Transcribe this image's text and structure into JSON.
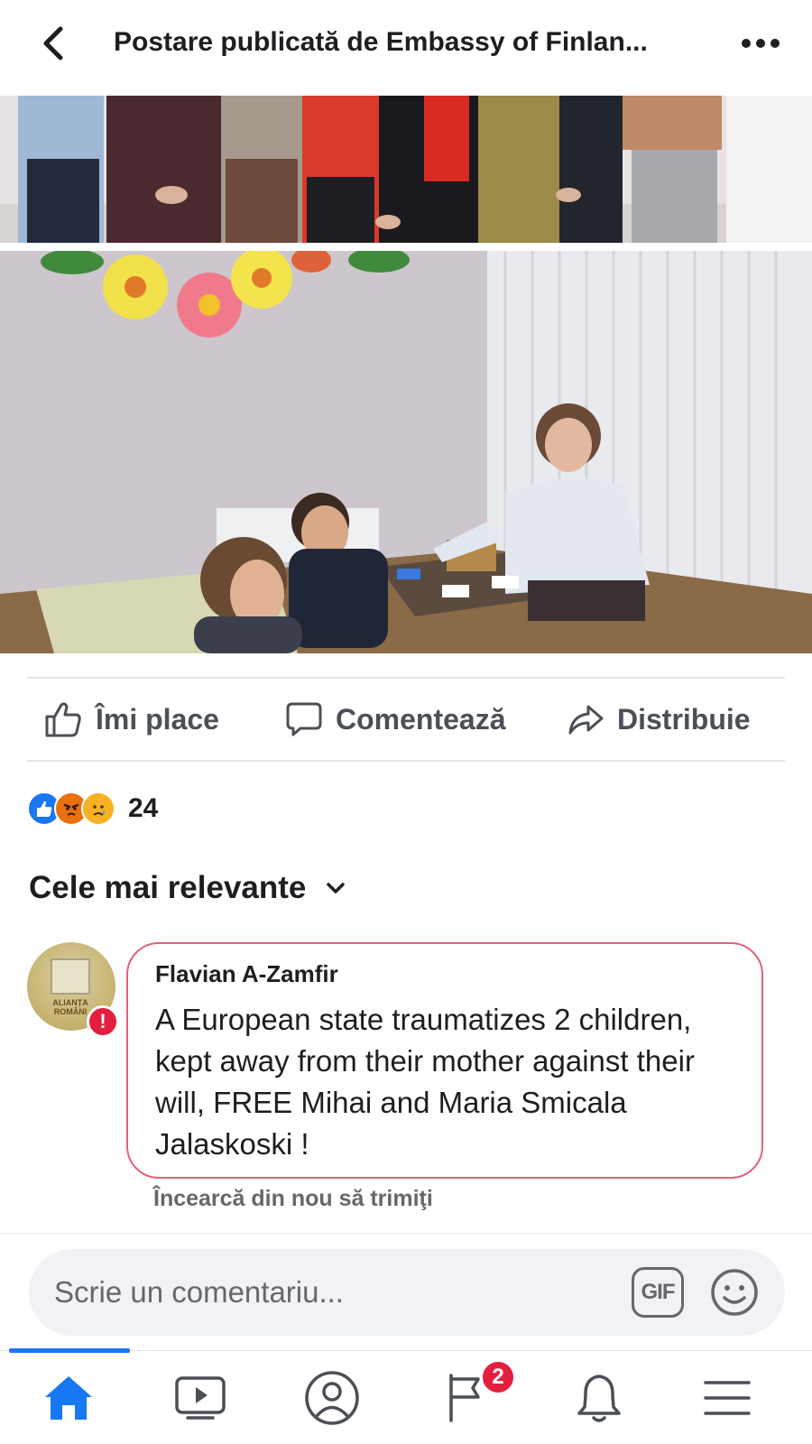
{
  "header": {
    "title": "Postare publicată de Embassy of Finlan...",
    "back_icon": "chevron-left-icon",
    "more_icon": "more-horizontal-icon"
  },
  "actions": {
    "like_label": "Îmi place",
    "comment_label": "Comentează",
    "share_label": "Distribuie"
  },
  "reactions": {
    "types": [
      "like",
      "angry",
      "sad"
    ],
    "count": "24"
  },
  "comments": {
    "sort_label": "Cele mai relevante",
    "items": [
      {
        "author": "Flavian A-Zamfir",
        "text": "A European state traumatizes 2 children, kept away from their mother against their will, FREE Mihai and Maria Smicala Jalaskoski !",
        "status": "Încearcă din nou să trimiţi",
        "avatar_text": "ALIANȚA ROMÂNI",
        "error": true
      }
    ]
  },
  "composer": {
    "placeholder": "Scrie un comentariu...",
    "gif_label": "GIF"
  },
  "nav": {
    "items": [
      "home",
      "video",
      "profile",
      "pages",
      "notifications",
      "menu"
    ],
    "active": "home",
    "pages_badge": "2"
  },
  "colors": {
    "accent": "#1877f2",
    "error": "#e41e3f",
    "bubble_border": "#e0627a",
    "muted": "#65676b"
  }
}
